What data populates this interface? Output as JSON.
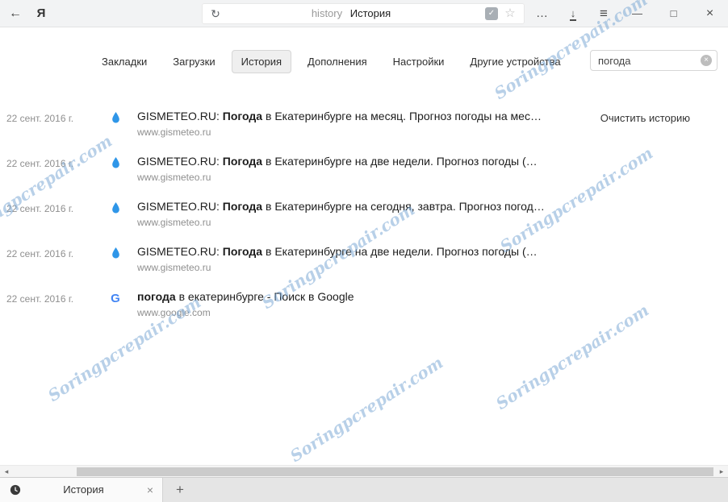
{
  "watermark_text": "Soringpcrepair.com",
  "toolbar": {
    "back_icon": "←",
    "logo_text": "Я",
    "refresh_icon": "↻",
    "address_prefix": "history",
    "address_title": "История",
    "star_icon": "☆",
    "more_icon": "…",
    "download_icon": "↓",
    "menu_icon": "≡",
    "minimize_icon": "—",
    "maximize_icon": "□",
    "close_icon": "×"
  },
  "nav_tabs": [
    {
      "label": "Закладки",
      "active": false
    },
    {
      "label": "Загрузки",
      "active": false
    },
    {
      "label": "История",
      "active": true
    },
    {
      "label": "Дополнения",
      "active": false
    },
    {
      "label": "Настройки",
      "active": false
    },
    {
      "label": "Другие устройства",
      "active": false
    }
  ],
  "search": {
    "value": "погода",
    "clear_icon": "×"
  },
  "actions": {
    "clear_history": "Очистить историю"
  },
  "history_rows": [
    {
      "date": "22 сент. 2016 г.",
      "icon": "gismeteo-droplet",
      "prefix": "GISMETEO.RU: ",
      "highlight": "Погода",
      "suffix": " в Екатеринбурге на месяц. Прогноз погоды на мес…",
      "url": "www.gismeteo.ru"
    },
    {
      "date": "22 сент. 2016 г.",
      "icon": "gismeteo-droplet",
      "prefix": "GISMETEO.RU: ",
      "highlight": "Погода",
      "suffix": " в Екатеринбурге на две недели. Прогноз погоды (…",
      "url": "www.gismeteo.ru"
    },
    {
      "date": "22 сент. 2016 г.",
      "icon": "gismeteo-droplet",
      "prefix": "GISMETEO.RU: ",
      "highlight": "Погода",
      "suffix": " в Екатеринбурге на сегодня, завтра. Прогноз погод…",
      "url": "www.gismeteo.ru"
    },
    {
      "date": "22 сент. 2016 г.",
      "icon": "gismeteo-droplet",
      "prefix": "GISMETEO.RU: ",
      "highlight": "Погода",
      "suffix": " в Екатеринбурге на две недели. Прогноз погоды (…",
      "url": "www.gismeteo.ru"
    },
    {
      "date": "22 сент. 2016 г.",
      "icon": "google-g",
      "prefix": "",
      "highlight": "погода",
      "suffix": " в екатеринбурге - Поиск в Google",
      "url": "www.google.com"
    }
  ],
  "scrollbar": {
    "left_arrow": "◂",
    "right_arrow": "▸"
  },
  "tab_strip": {
    "active_tab_label": "История",
    "close_icon": "×",
    "new_tab_icon": "+"
  }
}
